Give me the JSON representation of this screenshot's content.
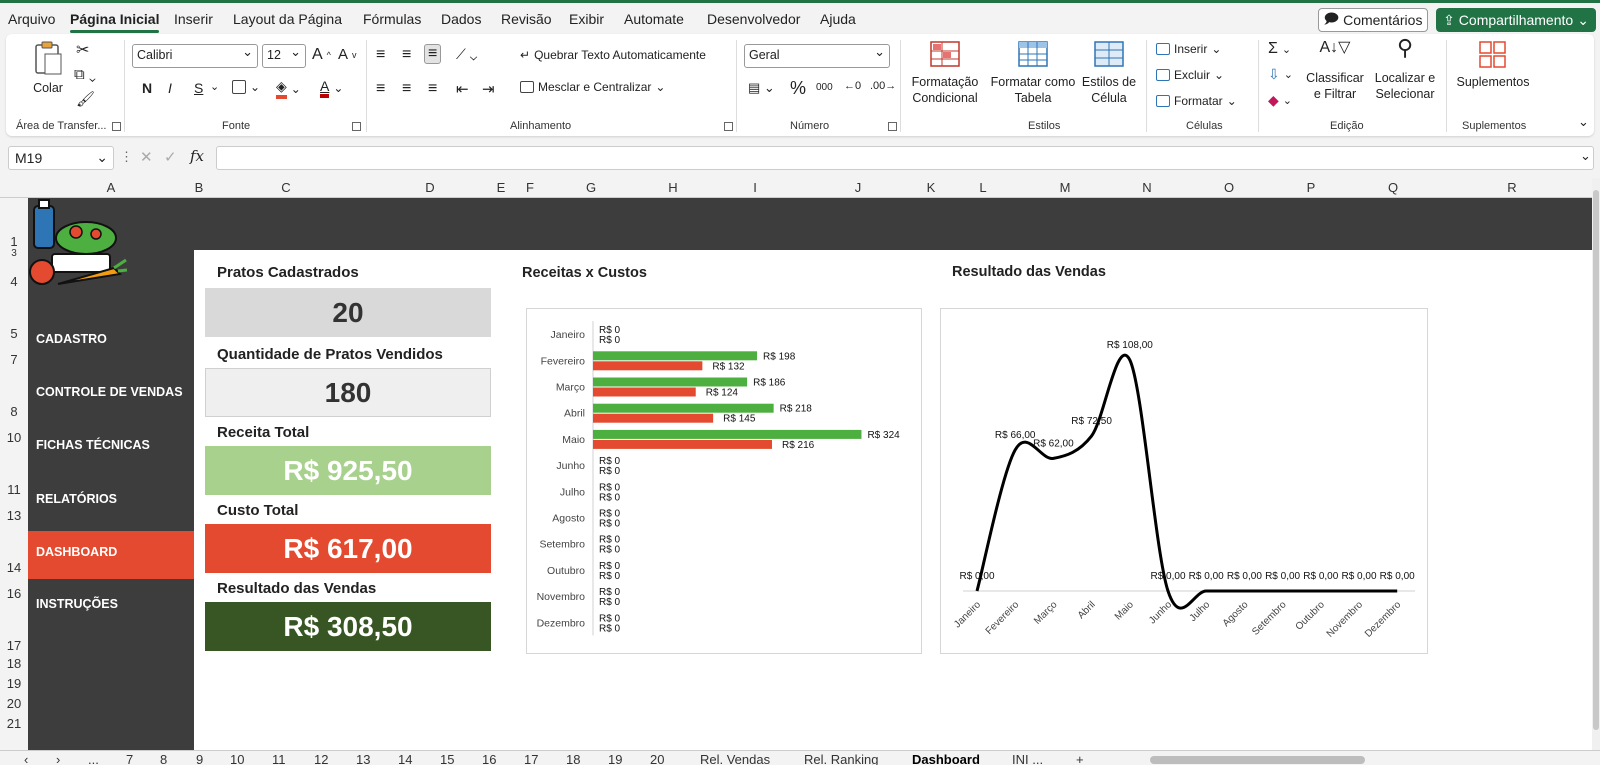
{
  "menu": {
    "tabs": [
      "Arquivo",
      "Página Inicial",
      "Inserir",
      "Layout da Página",
      "Fórmulas",
      "Dados",
      "Revisão",
      "Exibir",
      "Automate",
      "Desenvolvedor",
      "Ajuda"
    ],
    "active": "Página Inicial",
    "comments": "Comentários",
    "share": "Compartilhamento"
  },
  "ribbon": {
    "clipboard": {
      "paste": "Colar",
      "label": "Área de Transfer..."
    },
    "font": {
      "name": "Calibri",
      "size": "12",
      "bold": "N",
      "italic": "I",
      "underline": "S",
      "label": "Fonte"
    },
    "alignment": {
      "wrap": "Quebrar Texto Automaticamente",
      "merge": "Mesclar e Centralizar",
      "label": "Alinhamento"
    },
    "number": {
      "format": "Geral",
      "percent": "%",
      "thousands": "000",
      "label": "Número"
    },
    "styles": {
      "conditional": [
        "Formatação",
        "Condicional"
      ],
      "table": [
        "Formatar como",
        "Tabela"
      ],
      "cell": [
        "Estilos de",
        "Célula"
      ],
      "label": "Estilos"
    },
    "cells": {
      "insert": "Inserir",
      "delete": "Excluir",
      "format": "Formatar",
      "label": "Células"
    },
    "editing": {
      "sort": [
        "Classificar",
        "e Filtrar"
      ],
      "find": [
        "Localizar e",
        "Selecionar"
      ],
      "label": "Edição"
    },
    "addins": {
      "button": "Suplementos",
      "label": "Suplementos"
    }
  },
  "formula_bar": {
    "name_box": "M19",
    "fx": "fx",
    "value": ""
  },
  "columns": [
    "A",
    "B",
    "C",
    "D",
    "E",
    "F",
    "G",
    "H",
    "I",
    "J",
    "K",
    "L",
    "M",
    "N",
    "O",
    "P",
    "Q",
    "R"
  ],
  "rows": [
    "1",
    "3",
    "4",
    "5",
    "7",
    "8",
    "10",
    "11",
    "13",
    "14",
    "16",
    "17",
    "18",
    "19",
    "20",
    "21"
  ],
  "sidebar": {
    "items": [
      {
        "label": "CADASTRO"
      },
      {
        "label": "CONTROLE DE VENDAS"
      },
      {
        "label": "FICHAS TÉCNICAS"
      },
      {
        "label": "RELATÓRIOS"
      },
      {
        "label": "DASHBOARD"
      },
      {
        "label": "INSTRUÇÕES"
      }
    ],
    "active": "DASHBOARD"
  },
  "kpis": [
    {
      "title": "Pratos Cadastrados",
      "value": "20",
      "bg": "#d9d9d9",
      "fg": "#333333"
    },
    {
      "title": "Quantidade de Pratos Vendidos",
      "value": "180",
      "bg": "#efefef",
      "fg": "#333333"
    },
    {
      "title": "Receita Total",
      "value": "R$ 925,50",
      "bg": "#a9d18e",
      "fg": "#ffffff"
    },
    {
      "title": "Custo Total",
      "value": "R$ 617,00",
      "bg": "#e34a2f",
      "fg": "#ffffff"
    },
    {
      "title": "Resultado das Vendas",
      "value": "R$ 308,50",
      "bg": "#375623",
      "fg": "#ffffff"
    }
  ],
  "charts": {
    "bar_title": "Receitas x Custos",
    "line_title": "Resultado das Vendas"
  },
  "chart_data": [
    {
      "type": "bar",
      "title": "Receitas x Custos",
      "orientation": "horizontal",
      "categories": [
        "Janeiro",
        "Fevereiro",
        "Março",
        "Abril",
        "Maio",
        "Junho",
        "Julho",
        "Agosto",
        "Setembro",
        "Outubro",
        "Novembro",
        "Dezembro"
      ],
      "series": [
        {
          "values": [
            0,
            198,
            186,
            218,
            324,
            0,
            0,
            0,
            0,
            0,
            0,
            0
          ],
          "color": "#4caf3f"
        },
        {
          "values": [
            0,
            132,
            124,
            145,
            216,
            0,
            0,
            0,
            0,
            0,
            0,
            0
          ],
          "color": "#e34a2f"
        }
      ],
      "label_prefix": "R$ ",
      "xlim": [
        0,
        350
      ],
      "grid": false
    },
    {
      "type": "line",
      "title": "Resultado das Vendas",
      "categories": [
        "Janeiro",
        "Fevereiro",
        "Março",
        "Abril",
        "Maio",
        "Junho",
        "Julho",
        "Agosto",
        "Setembro",
        "Outubro",
        "Novembro",
        "Dezembro"
      ],
      "values": [
        0,
        66,
        62,
        72.5,
        108,
        0,
        0,
        0,
        0,
        0,
        0,
        0
      ],
      "labels": [
        "R$ 0,00",
        "R$ 66,00",
        "R$ 62,00",
        "R$ 72,50",
        "R$ 108,00",
        "R$ 0,00",
        "R$ 0,00",
        "R$ 0,00",
        "R$ 0,00",
        "R$ 0,00",
        "R$ 0,00",
        "R$ 0,00"
      ],
      "color": "#000000",
      "smooth": true,
      "ylim": [
        0,
        115
      ],
      "grid": false
    }
  ],
  "sheet_tabs": [
    "...",
    "7",
    "8",
    "9",
    "10",
    "11",
    "12",
    "13",
    "14",
    "15",
    "16",
    "17",
    "18",
    "19",
    "20",
    "Rel. Vendas",
    "Rel. Ranking",
    "Dashboard",
    "INI ..."
  ],
  "active_sheet": "Dashboard"
}
